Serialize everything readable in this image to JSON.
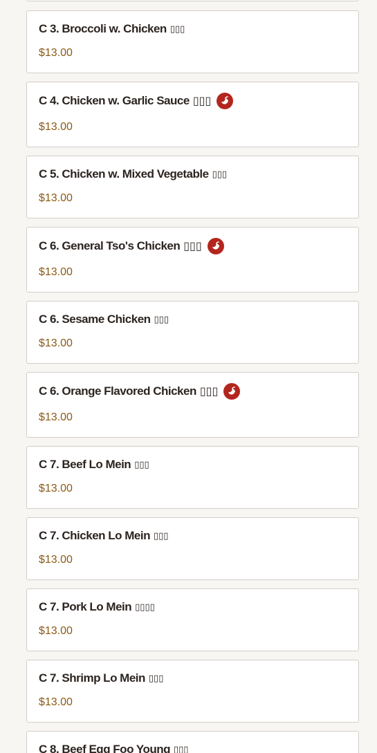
{
  "menu_items": [
    {
      "name": "",
      "cjk": "",
      "price": ""
    },
    {
      "name": "C 3. Broccoli w. Chicken",
      "cjk": "▯▯▯",
      "price": "$13.00",
      "spicy": false
    },
    {
      "name": "C 4. Chicken w. Garlic Sauce",
      "cjk": "▯▯▯",
      "price": "$13.00",
      "spicy": true
    },
    {
      "name": "C 5. Chicken w. Mixed Vegetable",
      "cjk": "▯▯▯",
      "price": "$13.00",
      "spicy": false
    },
    {
      "name": "C 6. General Tso's Chicken",
      "cjk": "▯▯▯",
      "price": "$13.00",
      "spicy": true
    },
    {
      "name": "C 6. Sesame Chicken",
      "cjk": "▯▯▯",
      "price": "$13.00",
      "spicy": false
    },
    {
      "name": "C 6. Orange Flavored Chicken",
      "cjk": "▯▯▯",
      "price": "$13.00",
      "spicy": true
    },
    {
      "name": "C 7. Beef Lo Mein",
      "cjk": "▯▯▯",
      "price": "$13.00",
      "spicy": false
    },
    {
      "name": "C 7. Chicken Lo Mein",
      "cjk": "▯▯▯",
      "price": "$13.00",
      "spicy": false
    },
    {
      "name": "C 7. Pork Lo Mein",
      "cjk": "▯▯▯▯",
      "price": "$13.00",
      "spicy": false
    },
    {
      "name": "C 7. Shrimp Lo Mein",
      "cjk": "▯▯▯",
      "price": "$13.00",
      "spicy": false
    },
    {
      "name": "C 8. Beef Egg Foo Young",
      "cjk": "▯▯▯",
      "price": "",
      "spicy": false
    }
  ],
  "icons": {
    "spicy": "chili-pepper-icon"
  },
  "colors": {
    "background": "#f8f6f3",
    "card_border": "#d2cec9",
    "price": "#8a5a14",
    "spicy_badge": "#b3261e"
  }
}
